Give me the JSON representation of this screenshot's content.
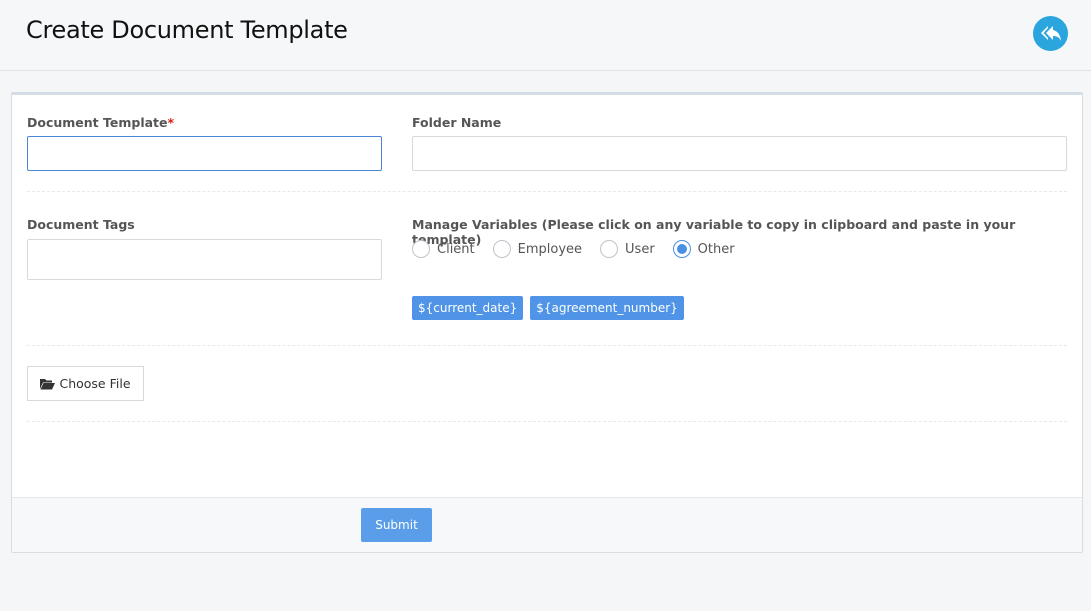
{
  "header": {
    "title": "Create Document Template",
    "back_icon": "reply-all-icon",
    "back_color": "#2aa5de"
  },
  "form": {
    "document_template": {
      "label": "Document Template",
      "required_mark": "*",
      "value": ""
    },
    "folder_name": {
      "label": "Folder Name",
      "value": ""
    },
    "document_tags": {
      "label": "Document Tags",
      "value": ""
    },
    "manage_variables": {
      "label": "Manage Variables (Please click on any variable to copy in clipboard and paste in your template)",
      "options": [
        {
          "label": "Client",
          "checked": false
        },
        {
          "label": "Employee",
          "checked": false
        },
        {
          "label": "User",
          "checked": false
        },
        {
          "label": "Other",
          "checked": true
        }
      ],
      "variables": [
        "${current_date}",
        "${agreement_number}"
      ]
    },
    "choose_file": {
      "label": "Choose File",
      "icon": "folder-open-icon"
    },
    "submit_label": "Submit"
  },
  "colors": {
    "accent": "#4f94e6",
    "required": "#d9230f"
  }
}
